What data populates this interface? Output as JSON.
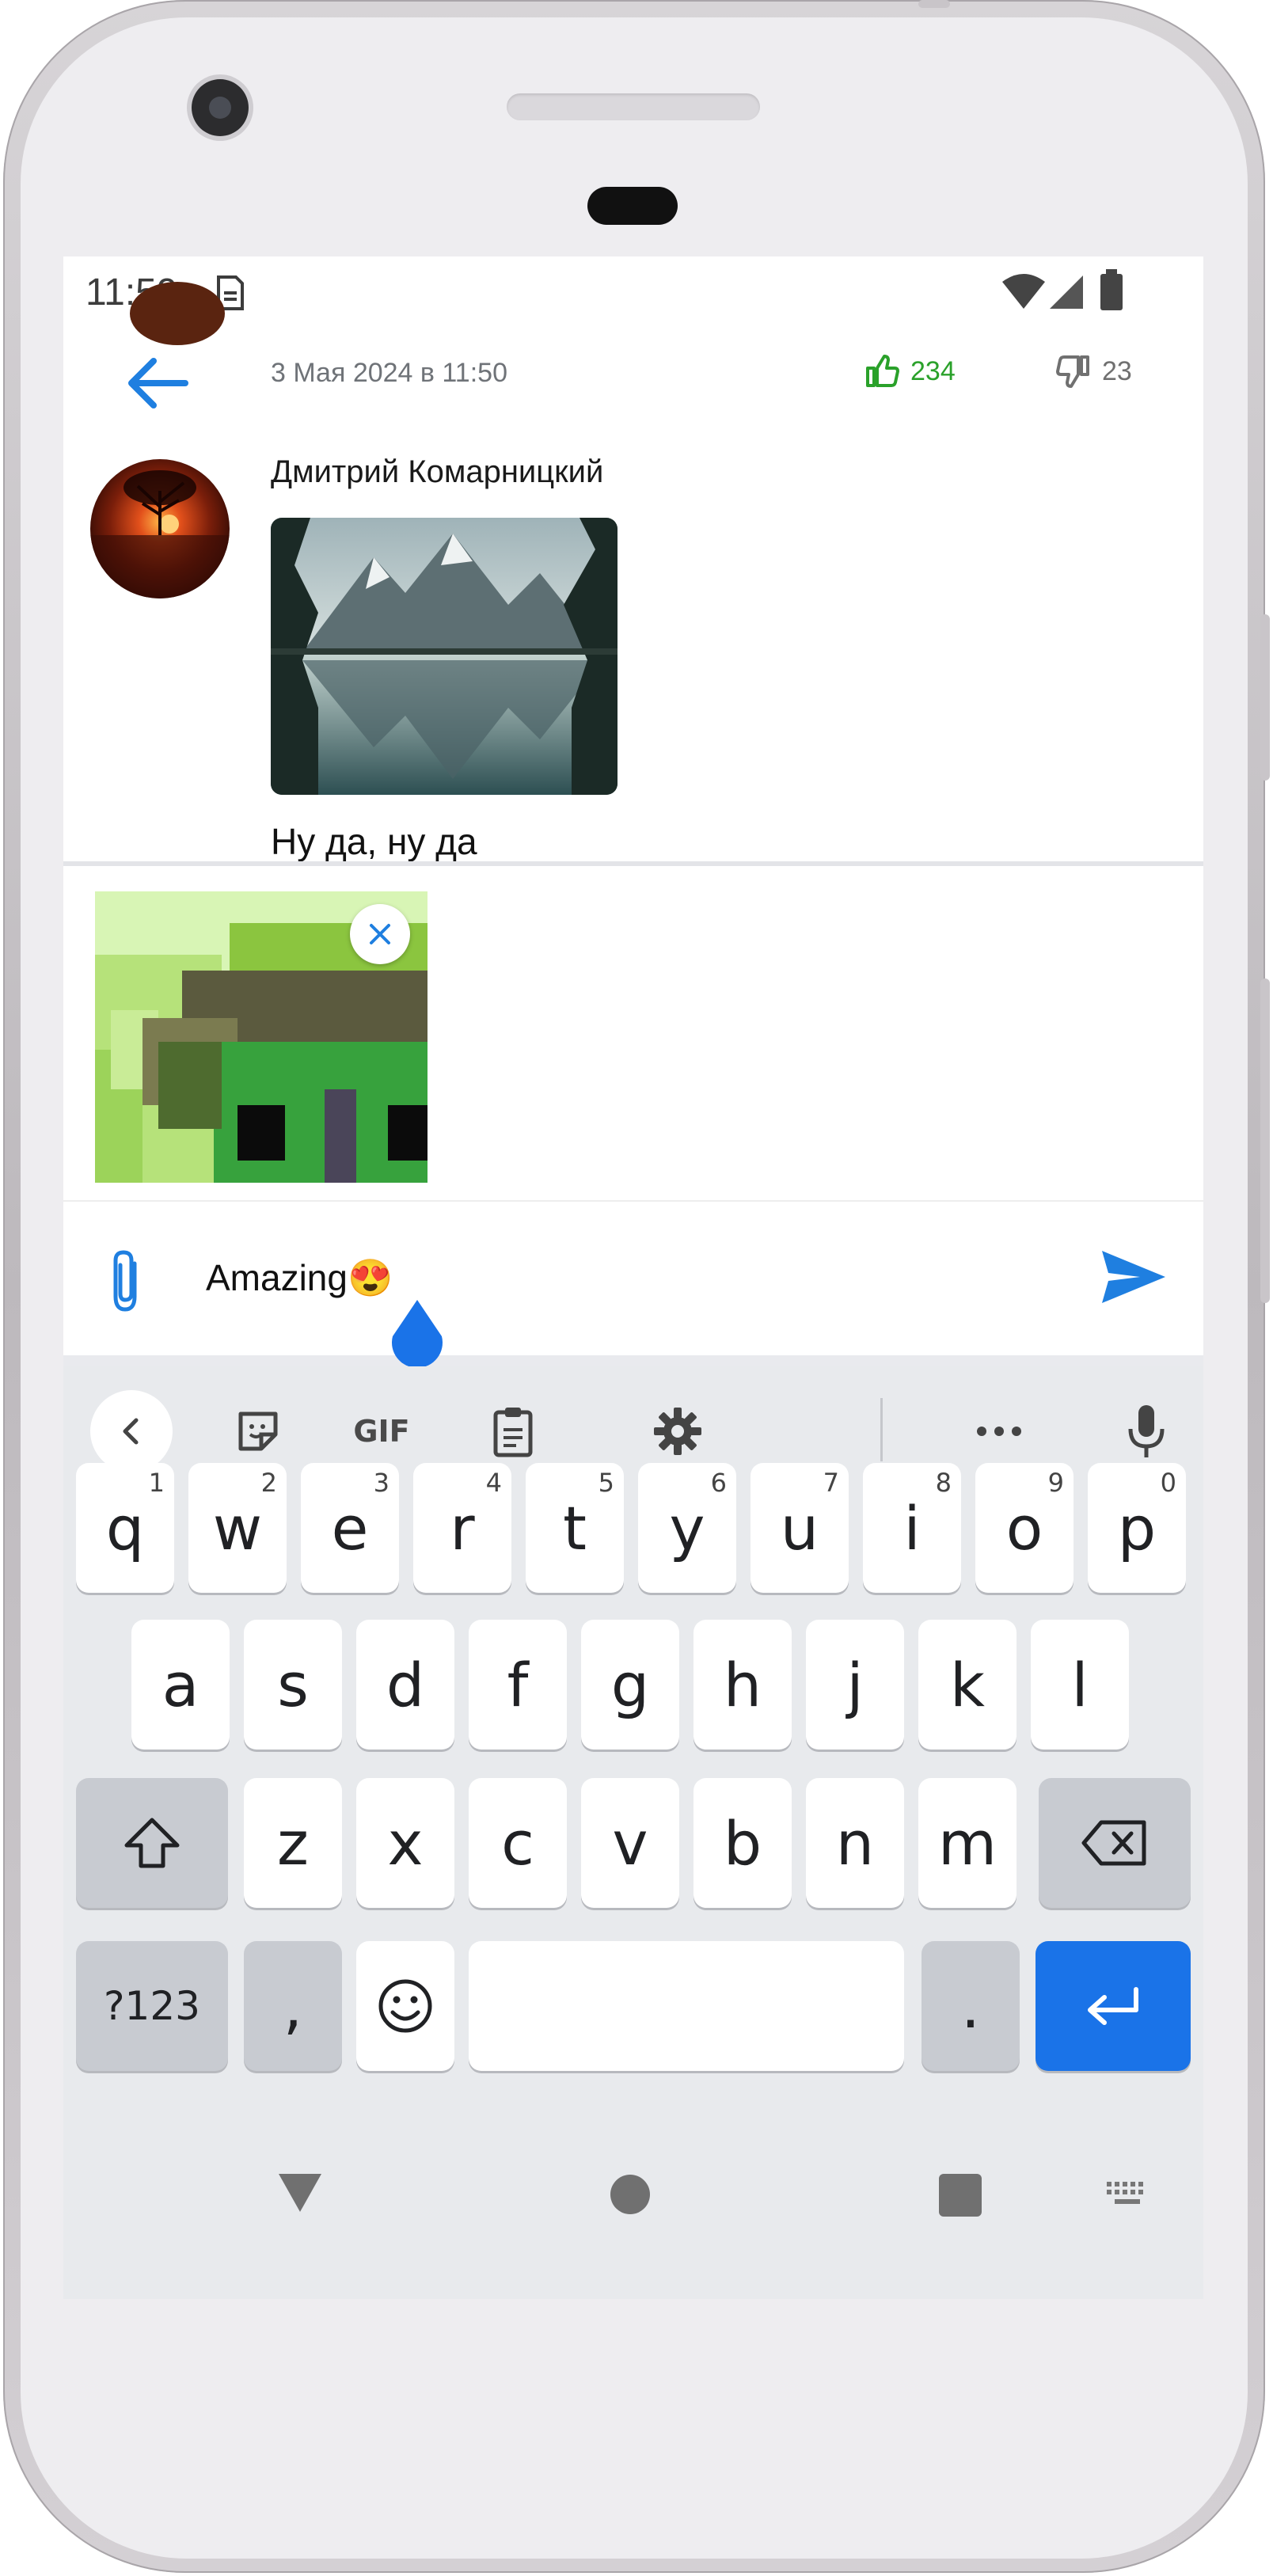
{
  "status_bar": {
    "time": "11:59",
    "icons": [
      "sim-icon",
      "wifi-icon",
      "signal-icon",
      "battery-icon"
    ]
  },
  "comment": {
    "date": "3 Мая 2024 в 11:50",
    "likes": "234",
    "dislikes": "23",
    "author": "Дмитрий Комарницкий",
    "text": "Ну да, ну да"
  },
  "attachment": {
    "remove_icon": "close-icon"
  },
  "composer": {
    "value": "Amazing😍",
    "attach_icon": "paperclip-icon",
    "send_icon": "send-icon"
  },
  "keyboard": {
    "toolbar": [
      "chevron-left-icon",
      "sticker-icon",
      "GIF",
      "clipboard-icon",
      "gear-icon",
      "more-icon",
      "mic-icon"
    ],
    "row1": [
      {
        "key": "q",
        "hint": "1"
      },
      {
        "key": "w",
        "hint": "2"
      },
      {
        "key": "e",
        "hint": "3"
      },
      {
        "key": "r",
        "hint": "4"
      },
      {
        "key": "t",
        "hint": "5"
      },
      {
        "key": "y",
        "hint": "6"
      },
      {
        "key": "u",
        "hint": "7"
      },
      {
        "key": "i",
        "hint": "8"
      },
      {
        "key": "o",
        "hint": "9"
      },
      {
        "key": "p",
        "hint": "0"
      }
    ],
    "row2": [
      "a",
      "s",
      "d",
      "f",
      "g",
      "h",
      "j",
      "k",
      "l"
    ],
    "row3": [
      "z",
      "x",
      "c",
      "v",
      "b",
      "n",
      "m"
    ],
    "symbols_label": "?123",
    "comma_label": ",",
    "period_label": "."
  },
  "colors": {
    "accent": "#1a73e8",
    "like_green": "#2aa12a",
    "send_blue": "#1f7fe0"
  }
}
